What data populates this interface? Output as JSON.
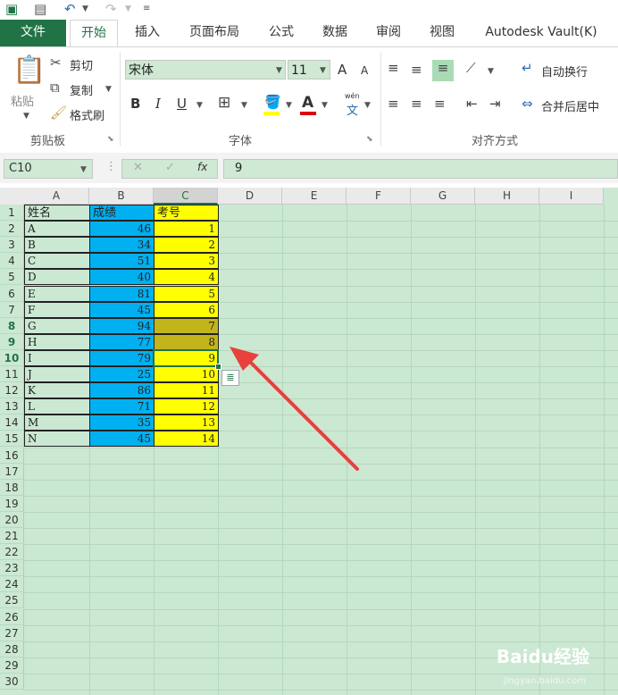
{
  "qat": {
    "excel_icon": "excel-icon",
    "save_icon": "save-icon",
    "undo_icon": "undo-icon",
    "redo_icon": "redo-icon"
  },
  "tabs": [
    "文件",
    "开始",
    "插入",
    "页面布局",
    "公式",
    "数据",
    "审阅",
    "视图",
    "Autodesk Vault(K)"
  ],
  "clipboard": {
    "paste": "粘贴",
    "cut": "剪切",
    "copy": "复制",
    "format_painter": "格式刷",
    "label": "剪贴板"
  },
  "font": {
    "name": "宋体",
    "size": "11",
    "grow": "A",
    "shrink": "A",
    "bold": "B",
    "italic": "I",
    "underline": "U",
    "wen": "wén",
    "wen_char": "文",
    "label": "字体"
  },
  "alignment": {
    "wrap": "自动换行",
    "merge": "合并后居中",
    "label": "对齐方式"
  },
  "formula_bar": {
    "name_box": "C10",
    "fx": "fx",
    "value": "9"
  },
  "columns": [
    "A",
    "B",
    "C",
    "D",
    "E",
    "F",
    "G",
    "H",
    "I"
  ],
  "rows": [
    "1",
    "2",
    "3",
    "4",
    "5",
    "6",
    "7",
    "8",
    "9",
    "10",
    "11",
    "12",
    "13",
    "14",
    "15",
    "16",
    "17",
    "18",
    "19",
    "20",
    "21",
    "22",
    "23",
    "24",
    "25",
    "26",
    "27",
    "28",
    "29",
    "30"
  ],
  "headers": [
    "姓名",
    "成绩",
    "考号"
  ],
  "table": [
    {
      "name": "A",
      "score": "46",
      "id": "1"
    },
    {
      "name": "B",
      "score": "34",
      "id": "2"
    },
    {
      "name": "C",
      "score": "51",
      "id": "3"
    },
    {
      "name": "D",
      "score": "40",
      "id": "4"
    },
    {
      "name": "E",
      "score": "81",
      "id": "5"
    },
    {
      "name": "F",
      "score": "45",
      "id": "6"
    },
    {
      "name": "G",
      "score": "94",
      "id": "7"
    },
    {
      "name": "H",
      "score": "77",
      "id": "8"
    },
    {
      "name": "I",
      "score": "79",
      "id": "9"
    },
    {
      "name": "J",
      "score": "25",
      "id": "10"
    },
    {
      "name": "K",
      "score": "86",
      "id": "11"
    },
    {
      "name": "L",
      "score": "71",
      "id": "12"
    },
    {
      "name": "M",
      "score": "35",
      "id": "13"
    },
    {
      "name": "N",
      "score": "45",
      "id": "14"
    }
  ],
  "watermark": {
    "brand": "Baidu经验",
    "url": "jingyan.baidu.com"
  },
  "colors": {
    "excel_green": "#217346",
    "score_fill": "#00b0f0",
    "id_fill": "#ffff00",
    "selected_fill": "#c2b51c",
    "sheet_bg": "#cbe8d3",
    "arrow": "#e8403a"
  }
}
